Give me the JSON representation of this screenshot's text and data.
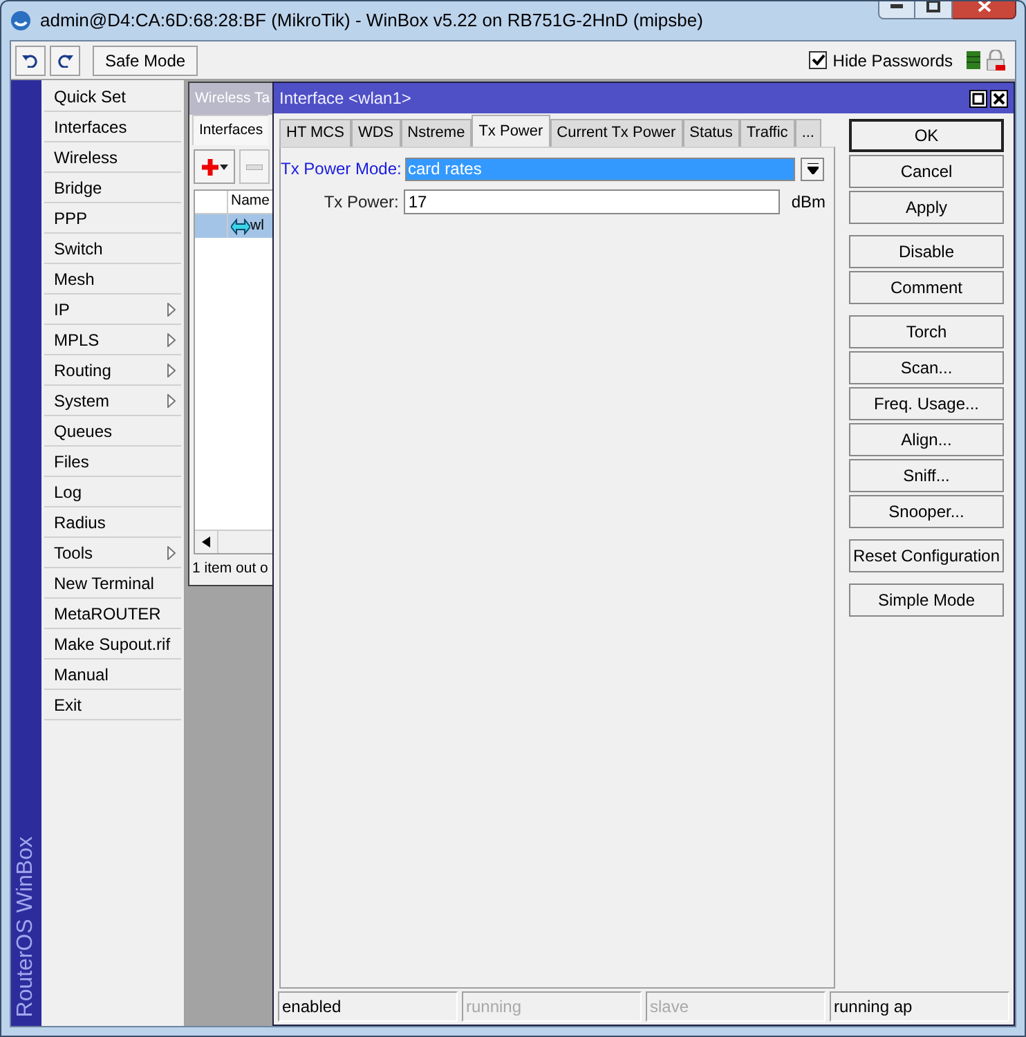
{
  "window": {
    "title": "admin@D4:CA:6D:68:28:BF (MikroTik) - WinBox v5.22 on RB751G-2HnD (mipsbe)"
  },
  "toolbar": {
    "safe_mode": "Safe Mode",
    "hide_passwords": {
      "label": "Hide Passwords",
      "checked": true
    }
  },
  "brand": "RouterOS WinBox",
  "menu": [
    {
      "label": "Quick Set",
      "submenu": false
    },
    {
      "label": "Interfaces",
      "submenu": false
    },
    {
      "label": "Wireless",
      "submenu": false
    },
    {
      "label": "Bridge",
      "submenu": false
    },
    {
      "label": "PPP",
      "submenu": false
    },
    {
      "label": "Switch",
      "submenu": false
    },
    {
      "label": "Mesh",
      "submenu": false
    },
    {
      "label": "IP",
      "submenu": true
    },
    {
      "label": "MPLS",
      "submenu": true
    },
    {
      "label": "Routing",
      "submenu": true
    },
    {
      "label": "System",
      "submenu": true
    },
    {
      "label": "Queues",
      "submenu": false
    },
    {
      "label": "Files",
      "submenu": false
    },
    {
      "label": "Log",
      "submenu": false
    },
    {
      "label": "Radius",
      "submenu": false
    },
    {
      "label": "Tools",
      "submenu": true
    },
    {
      "label": "New Terminal",
      "submenu": false
    },
    {
      "label": "MetaROUTER",
      "submenu": false
    },
    {
      "label": "Make Supout.rif",
      "submenu": false
    },
    {
      "label": "Manual",
      "submenu": false
    },
    {
      "label": "Exit",
      "submenu": false
    }
  ],
  "wireless_tables": {
    "title": "Wireless Ta",
    "tab": "Interfaces",
    "column": "Name",
    "row": {
      "name": "wl",
      "selected": true
    },
    "status": "1 item out o"
  },
  "dialog": {
    "title": "Interface <wlan1>",
    "tabs": [
      {
        "label": "HT MCS",
        "selected": false
      },
      {
        "label": "WDS",
        "selected": false
      },
      {
        "label": "Nstreme",
        "selected": false
      },
      {
        "label": "Tx Power",
        "selected": true
      },
      {
        "label": "Current Tx Power",
        "selected": false
      },
      {
        "label": "Status",
        "selected": false
      },
      {
        "label": "Traffic",
        "selected": false
      },
      {
        "label": "...",
        "selected": false
      }
    ],
    "fields": [
      {
        "kind": "dropdown",
        "label": "Tx Power Mode:",
        "value": "card rates",
        "focused": true
      },
      {
        "kind": "text",
        "label": "Tx Power:",
        "value": "17",
        "unit": "dBm",
        "focused": false
      }
    ],
    "button_groups": [
      [
        {
          "label": "OK",
          "default": true
        },
        {
          "label": "Cancel",
          "default": false
        },
        {
          "label": "Apply",
          "default": false
        }
      ],
      [
        {
          "label": "Disable",
          "default": false
        },
        {
          "label": "Comment",
          "default": false
        }
      ],
      [
        {
          "label": "Torch",
          "default": false
        },
        {
          "label": "Scan...",
          "default": false
        },
        {
          "label": "Freq. Usage...",
          "default": false
        },
        {
          "label": "Align...",
          "default": false
        },
        {
          "label": "Sniff...",
          "default": false
        },
        {
          "label": "Snooper...",
          "default": false
        }
      ],
      [
        {
          "label": "Reset Configuration",
          "default": false
        }
      ],
      [
        {
          "label": "Simple Mode",
          "default": false
        }
      ]
    ],
    "status_bar": [
      {
        "text": "enabled",
        "active": true
      },
      {
        "text": "running",
        "active": false
      },
      {
        "text": "slave",
        "active": false
      },
      {
        "text": "running ap",
        "active": true
      }
    ]
  }
}
